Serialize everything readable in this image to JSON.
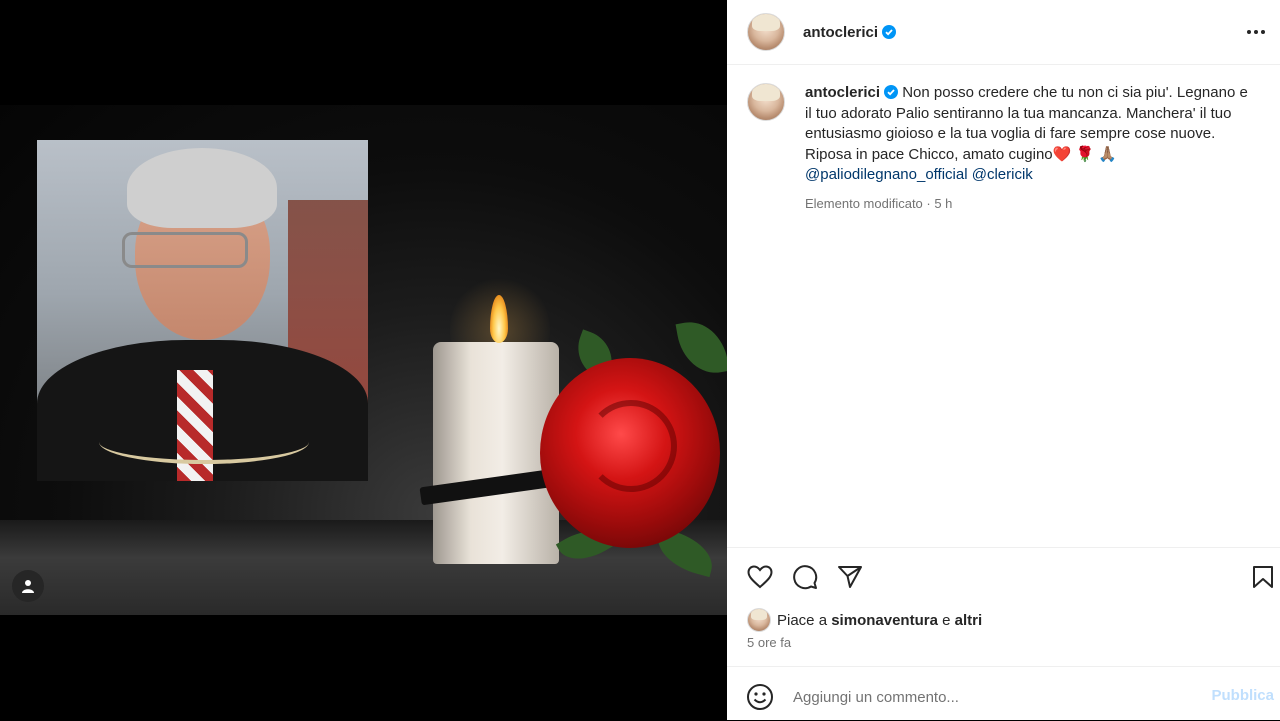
{
  "post": {
    "username": "antoclerici",
    "caption_text": "Non posso credere che tu non ci sia piu'. Legnano e il tuo adorato Palio sentiranno la tua mancanza. Manchera' il tuo entusiasmo gioioso e la tua voglia di fare sempre cose nuove. Riposa in pace Chicco, amato cugino",
    "caption_emojis": "❤️ 🌹 🙏🏽",
    "mentions": [
      "@paliodilegnano_official",
      "@clericik"
    ],
    "meta": "Elemento modificato · 5 h"
  },
  "likes": {
    "prefix": "Piace a",
    "user": "simonaventura",
    "conjunction": "e",
    "others": "altri"
  },
  "time_ago": "5 ore fa",
  "comment_box": {
    "placeholder": "Aggiungi un commento...",
    "post_label": "Pubblica"
  },
  "icons": [
    "user-tag-icon",
    "more-options-icon",
    "verified-badge-icon",
    "heart-icon",
    "comment-icon",
    "share-icon",
    "bookmark-icon",
    "emoji-icon"
  ]
}
